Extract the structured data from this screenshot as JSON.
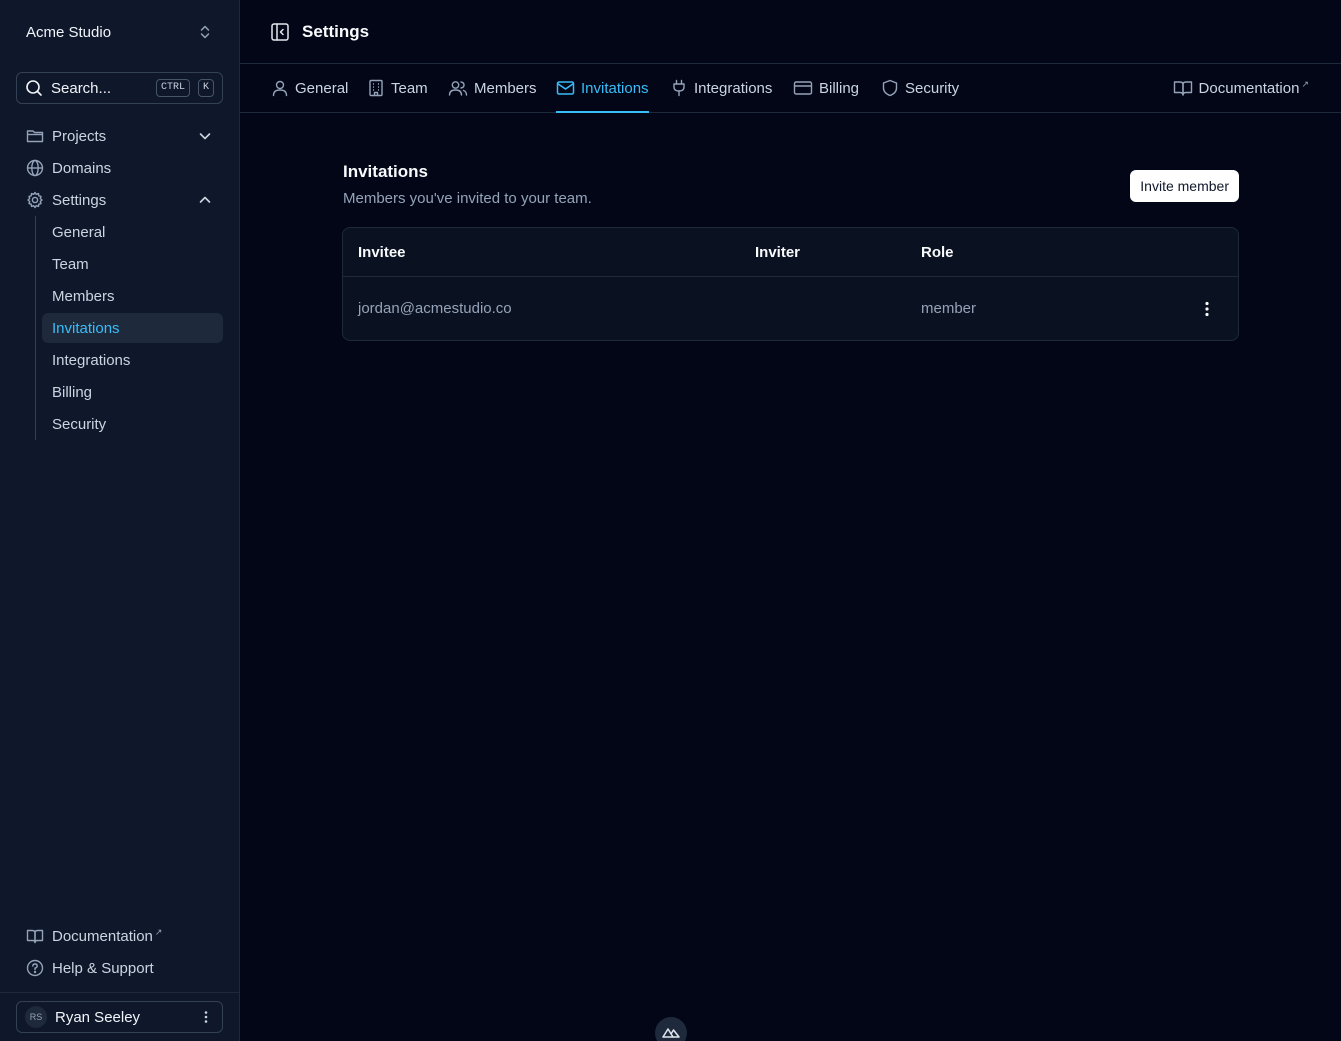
{
  "sidebar": {
    "team_name": "Acme Studio",
    "search": {
      "label": "Search...",
      "kbd_ctrl": "CTRL",
      "kbd_k": "K"
    },
    "nav": {
      "projects": "Projects",
      "domains": "Domains",
      "settings": "Settings"
    },
    "settings_items": [
      "General",
      "Team",
      "Members",
      "Invitations",
      "Integrations",
      "Billing",
      "Security"
    ],
    "active_item": "Invitations",
    "footer": {
      "documentation": "Documentation",
      "help": "Help & Support"
    },
    "user": {
      "initials": "RS",
      "name": "Ryan Seeley"
    }
  },
  "header": {
    "title": "Settings"
  },
  "tabs": {
    "general": "General",
    "team": "Team",
    "members": "Members",
    "invitations": "Invitations",
    "integrations": "Integrations",
    "billing": "Billing",
    "security": "Security",
    "documentation": "Documentation"
  },
  "invitations": {
    "title": "Invitations",
    "subtitle": "Members you've invited to your team.",
    "invite_button": "Invite member",
    "columns": {
      "invitee": "Invitee",
      "inviter": "Inviter",
      "role": "Role"
    },
    "rows": [
      {
        "invitee": "jordan@acmestudio.co",
        "inviter": "",
        "role": "member"
      }
    ]
  },
  "colors": {
    "accent": "#38bdf8",
    "background": "#020617",
    "sidebar": "#0f172a"
  }
}
